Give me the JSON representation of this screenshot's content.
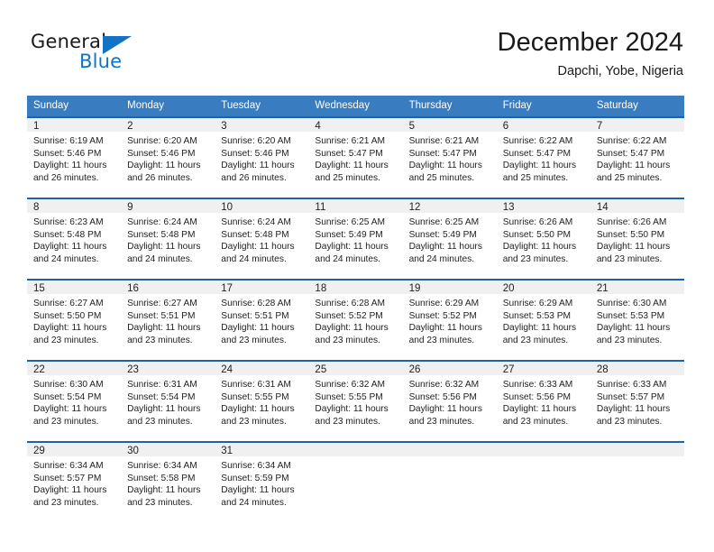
{
  "brand": {
    "name_part1": "General",
    "name_part2": "Blue",
    "logo_icon": "blue-triangle-icon",
    "accent_color": "#1273c4"
  },
  "header": {
    "title": "December 2024",
    "subtitle": "Dapchi, Yobe, Nigeria"
  },
  "theme": {
    "header_row_bg": "#3a7cc0",
    "day_header_bg": "#f0f0f0",
    "day_top_border": "#1c63ab"
  },
  "calendar": {
    "weekdays": [
      "Sunday",
      "Monday",
      "Tuesday",
      "Wednesday",
      "Thursday",
      "Friday",
      "Saturday"
    ],
    "labels": {
      "sunrise_prefix": "Sunrise:",
      "sunset_prefix": "Sunset:",
      "daylight_prefix": "Daylight:"
    },
    "weeks": [
      [
        {
          "date": "1",
          "sunrise": "Sunrise: 6:19 AM",
          "sunset": "Sunset: 5:46 PM",
          "daylight_line1": "Daylight: 11 hours",
          "daylight_line2": "and 26 minutes."
        },
        {
          "date": "2",
          "sunrise": "Sunrise: 6:20 AM",
          "sunset": "Sunset: 5:46 PM",
          "daylight_line1": "Daylight: 11 hours",
          "daylight_line2": "and 26 minutes."
        },
        {
          "date": "3",
          "sunrise": "Sunrise: 6:20 AM",
          "sunset": "Sunset: 5:46 PM",
          "daylight_line1": "Daylight: 11 hours",
          "daylight_line2": "and 26 minutes."
        },
        {
          "date": "4",
          "sunrise": "Sunrise: 6:21 AM",
          "sunset": "Sunset: 5:47 PM",
          "daylight_line1": "Daylight: 11 hours",
          "daylight_line2": "and 25 minutes."
        },
        {
          "date": "5",
          "sunrise": "Sunrise: 6:21 AM",
          "sunset": "Sunset: 5:47 PM",
          "daylight_line1": "Daylight: 11 hours",
          "daylight_line2": "and 25 minutes."
        },
        {
          "date": "6",
          "sunrise": "Sunrise: 6:22 AM",
          "sunset": "Sunset: 5:47 PM",
          "daylight_line1": "Daylight: 11 hours",
          "daylight_line2": "and 25 minutes."
        },
        {
          "date": "7",
          "sunrise": "Sunrise: 6:22 AM",
          "sunset": "Sunset: 5:47 PM",
          "daylight_line1": "Daylight: 11 hours",
          "daylight_line2": "and 25 minutes."
        }
      ],
      [
        {
          "date": "8",
          "sunrise": "Sunrise: 6:23 AM",
          "sunset": "Sunset: 5:48 PM",
          "daylight_line1": "Daylight: 11 hours",
          "daylight_line2": "and 24 minutes."
        },
        {
          "date": "9",
          "sunrise": "Sunrise: 6:24 AM",
          "sunset": "Sunset: 5:48 PM",
          "daylight_line1": "Daylight: 11 hours",
          "daylight_line2": "and 24 minutes."
        },
        {
          "date": "10",
          "sunrise": "Sunrise: 6:24 AM",
          "sunset": "Sunset: 5:48 PM",
          "daylight_line1": "Daylight: 11 hours",
          "daylight_line2": "and 24 minutes."
        },
        {
          "date": "11",
          "sunrise": "Sunrise: 6:25 AM",
          "sunset": "Sunset: 5:49 PM",
          "daylight_line1": "Daylight: 11 hours",
          "daylight_line2": "and 24 minutes."
        },
        {
          "date": "12",
          "sunrise": "Sunrise: 6:25 AM",
          "sunset": "Sunset: 5:49 PM",
          "daylight_line1": "Daylight: 11 hours",
          "daylight_line2": "and 24 minutes."
        },
        {
          "date": "13",
          "sunrise": "Sunrise: 6:26 AM",
          "sunset": "Sunset: 5:50 PM",
          "daylight_line1": "Daylight: 11 hours",
          "daylight_line2": "and 23 minutes."
        },
        {
          "date": "14",
          "sunrise": "Sunrise: 6:26 AM",
          "sunset": "Sunset: 5:50 PM",
          "daylight_line1": "Daylight: 11 hours",
          "daylight_line2": "and 23 minutes."
        }
      ],
      [
        {
          "date": "15",
          "sunrise": "Sunrise: 6:27 AM",
          "sunset": "Sunset: 5:50 PM",
          "daylight_line1": "Daylight: 11 hours",
          "daylight_line2": "and 23 minutes."
        },
        {
          "date": "16",
          "sunrise": "Sunrise: 6:27 AM",
          "sunset": "Sunset: 5:51 PM",
          "daylight_line1": "Daylight: 11 hours",
          "daylight_line2": "and 23 minutes."
        },
        {
          "date": "17",
          "sunrise": "Sunrise: 6:28 AM",
          "sunset": "Sunset: 5:51 PM",
          "daylight_line1": "Daylight: 11 hours",
          "daylight_line2": "and 23 minutes."
        },
        {
          "date": "18",
          "sunrise": "Sunrise: 6:28 AM",
          "sunset": "Sunset: 5:52 PM",
          "daylight_line1": "Daylight: 11 hours",
          "daylight_line2": "and 23 minutes."
        },
        {
          "date": "19",
          "sunrise": "Sunrise: 6:29 AM",
          "sunset": "Sunset: 5:52 PM",
          "daylight_line1": "Daylight: 11 hours",
          "daylight_line2": "and 23 minutes."
        },
        {
          "date": "20",
          "sunrise": "Sunrise: 6:29 AM",
          "sunset": "Sunset: 5:53 PM",
          "daylight_line1": "Daylight: 11 hours",
          "daylight_line2": "and 23 minutes."
        },
        {
          "date": "21",
          "sunrise": "Sunrise: 6:30 AM",
          "sunset": "Sunset: 5:53 PM",
          "daylight_line1": "Daylight: 11 hours",
          "daylight_line2": "and 23 minutes."
        }
      ],
      [
        {
          "date": "22",
          "sunrise": "Sunrise: 6:30 AM",
          "sunset": "Sunset: 5:54 PM",
          "daylight_line1": "Daylight: 11 hours",
          "daylight_line2": "and 23 minutes."
        },
        {
          "date": "23",
          "sunrise": "Sunrise: 6:31 AM",
          "sunset": "Sunset: 5:54 PM",
          "daylight_line1": "Daylight: 11 hours",
          "daylight_line2": "and 23 minutes."
        },
        {
          "date": "24",
          "sunrise": "Sunrise: 6:31 AM",
          "sunset": "Sunset: 5:55 PM",
          "daylight_line1": "Daylight: 11 hours",
          "daylight_line2": "and 23 minutes."
        },
        {
          "date": "25",
          "sunrise": "Sunrise: 6:32 AM",
          "sunset": "Sunset: 5:55 PM",
          "daylight_line1": "Daylight: 11 hours",
          "daylight_line2": "and 23 minutes."
        },
        {
          "date": "26",
          "sunrise": "Sunrise: 6:32 AM",
          "sunset": "Sunset: 5:56 PM",
          "daylight_line1": "Daylight: 11 hours",
          "daylight_line2": "and 23 minutes."
        },
        {
          "date": "27",
          "sunrise": "Sunrise: 6:33 AM",
          "sunset": "Sunset: 5:56 PM",
          "daylight_line1": "Daylight: 11 hours",
          "daylight_line2": "and 23 minutes."
        },
        {
          "date": "28",
          "sunrise": "Sunrise: 6:33 AM",
          "sunset": "Sunset: 5:57 PM",
          "daylight_line1": "Daylight: 11 hours",
          "daylight_line2": "and 23 minutes."
        }
      ],
      [
        {
          "date": "29",
          "sunrise": "Sunrise: 6:34 AM",
          "sunset": "Sunset: 5:57 PM",
          "daylight_line1": "Daylight: 11 hours",
          "daylight_line2": "and 23 minutes."
        },
        {
          "date": "30",
          "sunrise": "Sunrise: 6:34 AM",
          "sunset": "Sunset: 5:58 PM",
          "daylight_line1": "Daylight: 11 hours",
          "daylight_line2": "and 23 minutes."
        },
        {
          "date": "31",
          "sunrise": "Sunrise: 6:34 AM",
          "sunset": "Sunset: 5:59 PM",
          "daylight_line1": "Daylight: 11 hours",
          "daylight_line2": "and 24 minutes."
        },
        {
          "date": "",
          "sunrise": "",
          "sunset": "",
          "daylight_line1": "",
          "daylight_line2": ""
        },
        {
          "date": "",
          "sunrise": "",
          "sunset": "",
          "daylight_line1": "",
          "daylight_line2": ""
        },
        {
          "date": "",
          "sunrise": "",
          "sunset": "",
          "daylight_line1": "",
          "daylight_line2": ""
        },
        {
          "date": "",
          "sunrise": "",
          "sunset": "",
          "daylight_line1": "",
          "daylight_line2": ""
        }
      ]
    ]
  }
}
